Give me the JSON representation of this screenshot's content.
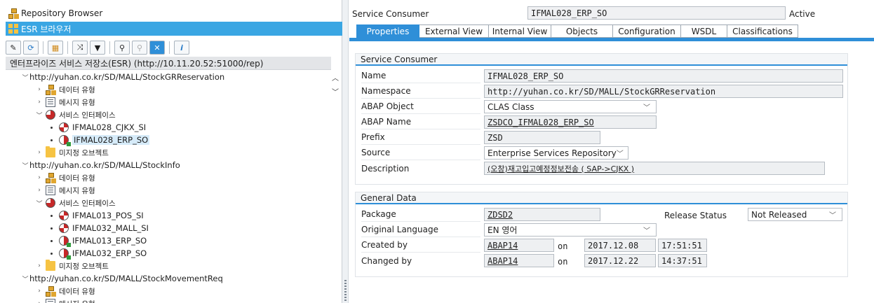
{
  "left": {
    "repo_browser_label": "Repository Browser",
    "esr_browser_label": "ESR 브라우저",
    "toolbar_icons": [
      "wand-icon",
      "refresh-icon",
      "layout-icon",
      "connect-icon",
      "filter-icon",
      "binoculars-icon",
      "binoculars-disabled-icon",
      "close-icon",
      "info-icon"
    ],
    "esr_header": "엔터프라이즈 서비스 저장소(ESR) (http://10.11.20.52:51000/rep)",
    "tree": [
      {
        "text": "http://yuhan.co.kr/SD/MALL/StockGRReservation",
        "level": 0,
        "expanded": true,
        "icon": "none"
      },
      {
        "text": "데이터 유형",
        "level": 1,
        "expanded": false,
        "icon": "data-type-icon"
      },
      {
        "text": "메시지 유형",
        "level": 1,
        "expanded": false,
        "icon": "message-type-icon"
      },
      {
        "text": "서비스 인터페이스",
        "level": 1,
        "expanded": true,
        "icon": "service-interface-icon"
      },
      {
        "text": "IFMAL028_CJKX_SI",
        "level": 2,
        "icon": "service-icon",
        "selected": false
      },
      {
        "text": "IFMAL028_ERP_SO",
        "level": 2,
        "icon": "service-consumer-icon",
        "selected": true
      },
      {
        "text": "미지정 오브젝트",
        "level": 1,
        "expanded": false,
        "icon": "folder-icon"
      },
      {
        "text": "http://yuhan.co.kr/SD/MALL/StockInfo",
        "level": 0,
        "expanded": true,
        "icon": "none"
      },
      {
        "text": "데이터 유형",
        "level": 1,
        "expanded": false,
        "icon": "data-type-icon"
      },
      {
        "text": "메시지 유형",
        "level": 1,
        "expanded": false,
        "icon": "message-type-icon"
      },
      {
        "text": "서비스 인터페이스",
        "level": 1,
        "expanded": true,
        "icon": "service-interface-icon"
      },
      {
        "text": "IFMAL013_POS_SI",
        "level": 2,
        "icon": "service-icon"
      },
      {
        "text": "IFMAL032_MALL_SI",
        "level": 2,
        "icon": "service-icon"
      },
      {
        "text": "IFMAL013_ERP_SO",
        "level": 2,
        "icon": "service-consumer-icon"
      },
      {
        "text": "IFMAL032_ERP_SO",
        "level": 2,
        "icon": "service-consumer-icon"
      },
      {
        "text": "미지정 오브젝트",
        "level": 1,
        "expanded": false,
        "icon": "folder-icon"
      },
      {
        "text": "http://yuhan.co.kr/SD/MALL/StockMovementReq",
        "level": 0,
        "expanded": true,
        "icon": "none"
      },
      {
        "text": "데이터 유형",
        "level": 1,
        "expanded": false,
        "icon": "data-type-icon"
      },
      {
        "text": "메시지 유형",
        "level": 1,
        "expanded": false,
        "icon": "message-type-icon"
      }
    ]
  },
  "right": {
    "object_type_label": "Service Consumer",
    "object_name": "IFMAL028_ERP_SO",
    "status": "Active",
    "tabs": [
      "Properties",
      "External View",
      "Internal View",
      "Objects",
      "Configuration",
      "WSDL",
      "Classifications"
    ],
    "active_tab": "Properties",
    "group1": {
      "title": "Service Consumer",
      "name_label": "Name",
      "name_value": "IFMAL028_ERP_SO",
      "namespace_label": "Namespace",
      "namespace_value": "http://yuhan.co.kr/SD/MALL/StockGRReservation",
      "abap_object_label": "ABAP Object",
      "abap_object_value": "CLAS Class",
      "abap_name_label": "ABAP Name",
      "abap_name_value": "ZSDCO_IFMAL028_ERP_SO",
      "prefix_label": "Prefix",
      "prefix_value": "ZSD",
      "source_label": "Source",
      "source_value": "Enterprise Services Repository",
      "description_label": "Description",
      "description_value": "(오창)재고입고예정정보전송 ( SAP->CJKX )"
    },
    "group2": {
      "title": "General Data",
      "package_label": "Package",
      "package_value": "ZDSD2",
      "release_status_label": "Release Status",
      "release_status_value": "Not Released",
      "orig_lang_label": "Original Language",
      "orig_lang_value": "EN 영어",
      "created_by_label": "Created by",
      "created_by_user": "ABAP14",
      "created_on_label": "on",
      "created_date": "2017.12.08",
      "created_time": "17:51:51",
      "changed_by_label": "Changed by",
      "changed_by_user": "ABAP14",
      "changed_on_label": "on",
      "changed_date": "2017.12.22",
      "changed_time": "14:37:51"
    }
  }
}
